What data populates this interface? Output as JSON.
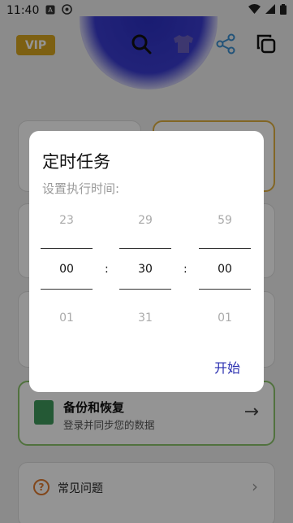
{
  "status_bar": {
    "time": "11:40"
  },
  "app_bar": {
    "vip_label": "VIP"
  },
  "background": {
    "backup_card": {
      "title": "备份和恢复",
      "subtitle": "登录并同步您的数据"
    },
    "faq_item": {
      "label": "常见问题"
    }
  },
  "dialog": {
    "title": "定时任务",
    "subtitle": "设置执行时间:",
    "hours": {
      "prev": "23",
      "current": "00",
      "next": "01"
    },
    "minutes": {
      "prev": "29",
      "current": "30",
      "next": "31"
    },
    "seconds": {
      "prev": "59",
      "current": "00",
      "next": "01"
    },
    "separator": ":",
    "start_label": "开始"
  },
  "colors": {
    "accent": "#2a2fb0",
    "vip": "#d8a520",
    "backup_border": "#8cc46c"
  }
}
